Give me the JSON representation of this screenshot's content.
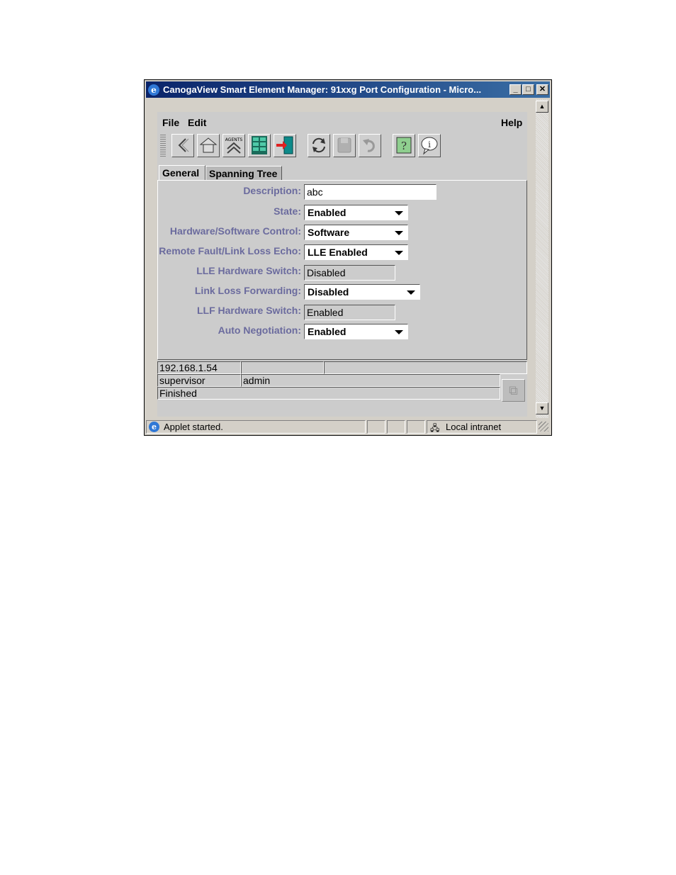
{
  "window": {
    "title": "CanogaView Smart Element Manager: 91xxg Port Configuration - Micro...",
    "minimize": "_",
    "maximize": "□",
    "close": "✕"
  },
  "menubar": {
    "file": "File",
    "edit": "Edit",
    "help": "Help"
  },
  "toolbar": {
    "icons": [
      "back-icon",
      "home-icon",
      "agents-icon",
      "grid-icon",
      "exit-door-icon",
      "refresh-icon",
      "save-icon",
      "undo-icon",
      "help-icon",
      "info-balloon-icon"
    ],
    "agents_text": "AGENTS"
  },
  "tabs": {
    "general": "General",
    "spanning_tree": "Spanning Tree"
  },
  "form": {
    "description_label": "Description:",
    "description_value": "abc",
    "state_label": "State:",
    "state_value": "Enabled",
    "hw_sw_label": "Hardware/Software Control:",
    "hw_sw_value": "Software",
    "rf_lle_label": "Remote Fault/Link Loss Echo:",
    "rf_lle_value": "LLE Enabled",
    "lle_hw_label": "LLE Hardware Switch:",
    "lle_hw_value": "Disabled",
    "llf_label": "Link Loss Forwarding:",
    "llf_value": "Disabled",
    "llf_hw_label": "LLF Hardware Switch:",
    "llf_hw_value": "Enabled",
    "autoneg_label": "Auto Negotiation:",
    "autoneg_value": "Enabled"
  },
  "status": {
    "ip": "192.168.1.54",
    "user_role": "supervisor",
    "user_name": "admin",
    "message": "Finished"
  },
  "browser_status": {
    "applet": "Applet started.",
    "zone": "Local intranet"
  },
  "colors": {
    "title_bar": "#0a246a",
    "label": "#6b6b9e",
    "panel": "#cccccc"
  }
}
